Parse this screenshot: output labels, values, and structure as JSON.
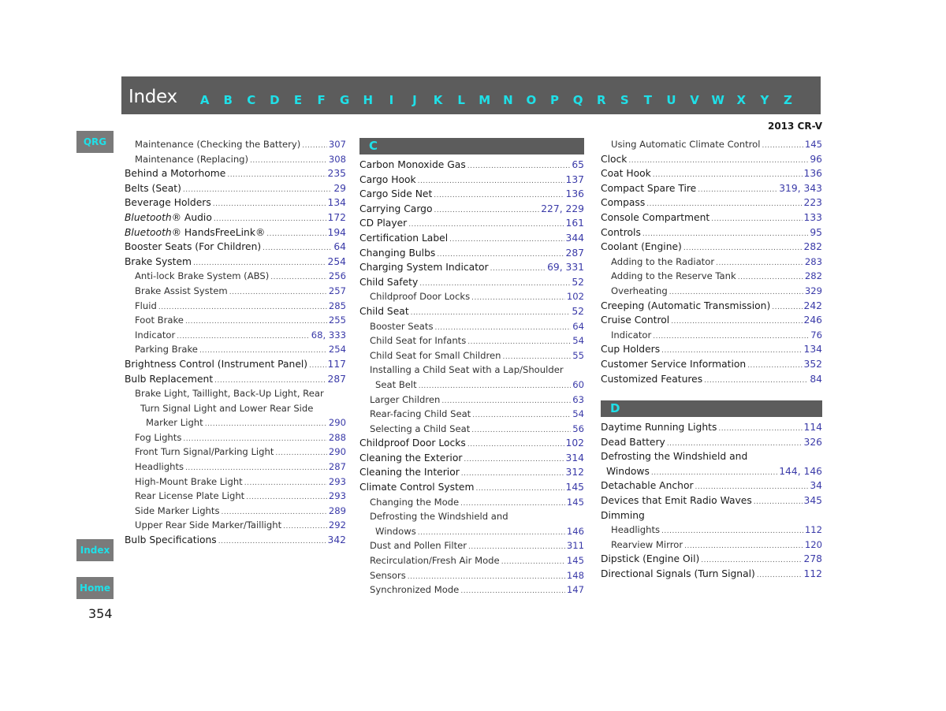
{
  "header": {
    "title": "Index",
    "letters": [
      "A",
      "B",
      "C",
      "D",
      "E",
      "F",
      "G",
      "H",
      "I",
      "J",
      "K",
      "L",
      "M",
      "N",
      "O",
      "P",
      "Q",
      "R",
      "S",
      "T",
      "U",
      "V",
      "W",
      "X",
      "Y",
      "Z"
    ]
  },
  "model": "2013 CR-V",
  "side_buttons": {
    "qrg": "QRG",
    "index": "Index",
    "home": "Home"
  },
  "page_number": "354",
  "columns": {
    "left": [
      {
        "label": "Maintenance (Checking the Battery)",
        "page": "307",
        "level": 1
      },
      {
        "label": "Maintenance (Replacing)",
        "page": "308",
        "level": 1
      },
      {
        "label": "Behind a Motorhome",
        "page": "235",
        "level": 0
      },
      {
        "label": "Belts (Seat)",
        "page": "29",
        "level": 0
      },
      {
        "label": "Beverage Holders",
        "page": "134",
        "level": 0
      },
      {
        "label_italic": "Bluetooth",
        "label": "® Audio",
        "page": "172",
        "level": 0
      },
      {
        "label_italic": "Bluetooth",
        "label": "® HandsFreeLink®",
        "page": "194",
        "level": 0
      },
      {
        "label": "Booster Seats (For Children)",
        "page": "64",
        "level": 0
      },
      {
        "label": "Brake System",
        "page": "254",
        "level": 0
      },
      {
        "label": "Anti-lock Brake System (ABS)",
        "page": "256",
        "level": 1
      },
      {
        "label": "Brake Assist System",
        "page": "257",
        "level": 1
      },
      {
        "label": "Fluid",
        "page": "285",
        "level": 1
      },
      {
        "label": "Foot Brake",
        "page": "255",
        "level": 1
      },
      {
        "label": "Indicator",
        "page": "68, 333",
        "level": 1
      },
      {
        "label": "Parking Brake",
        "page": "254",
        "level": 1
      },
      {
        "label": "Brightness Control (Instrument Panel)",
        "page": "117",
        "level": 0
      },
      {
        "label": "Bulb Replacement",
        "page": "287",
        "level": 0
      },
      {
        "label": "Brake Light, Taillight, Back-Up Light, Rear",
        "page": "",
        "level": 1
      },
      {
        "label": "Turn Signal Light and Lower Rear Side",
        "page": "",
        "level": 2
      },
      {
        "label": "Marker Light",
        "page": "290",
        "level": 3
      },
      {
        "label": "Fog Lights",
        "page": "288",
        "level": 1
      },
      {
        "label": "Front Turn Signal/Parking Light",
        "page": "290",
        "level": 1
      },
      {
        "label": "Headlights",
        "page": "287",
        "level": 1
      },
      {
        "label": "High-Mount Brake Light",
        "page": "293",
        "level": 1
      },
      {
        "label": "Rear License Plate Light",
        "page": "293",
        "level": 1
      },
      {
        "label": "Side Marker Lights",
        "page": "289",
        "level": 1
      },
      {
        "label": "Upper Rear Side Marker/Taillight",
        "page": "292",
        "level": 1
      },
      {
        "label": "Bulb Specifications",
        "page": "342",
        "level": 0
      }
    ],
    "middle_section": "C",
    "middle": [
      {
        "label": "Carbon Monoxide Gas",
        "page": "65",
        "level": 0
      },
      {
        "label": "Cargo Hook",
        "page": "137",
        "level": 0
      },
      {
        "label": "Cargo Side Net",
        "page": "136",
        "level": 0
      },
      {
        "label": "Carrying Cargo",
        "page": "227, 229",
        "level": 0
      },
      {
        "label": "CD Player",
        "page": "161",
        "level": 0
      },
      {
        "label": "Certification Label",
        "page": "344",
        "level": 0
      },
      {
        "label": "Changing Bulbs",
        "page": "287",
        "level": 0
      },
      {
        "label": "Charging System Indicator",
        "page": "69, 331",
        "level": 0
      },
      {
        "label": "Child Safety",
        "page": "52",
        "level": 0
      },
      {
        "label": "Childproof Door Locks",
        "page": "102",
        "level": 1
      },
      {
        "label": "Child Seat",
        "page": "52",
        "level": 0
      },
      {
        "label": "Booster Seats",
        "page": "64",
        "level": 1
      },
      {
        "label": "Child Seat for Infants",
        "page": "54",
        "level": 1
      },
      {
        "label": "Child Seat for Small Children",
        "page": "55",
        "level": 1
      },
      {
        "label": "Installing a Child Seat with a Lap/Shoulder",
        "page": "",
        "level": 1
      },
      {
        "label": "Seat Belt",
        "page": "60",
        "level": 2
      },
      {
        "label": "Larger Children",
        "page": "63",
        "level": 1
      },
      {
        "label": "Rear-facing Child Seat",
        "page": "54",
        "level": 1
      },
      {
        "label": "Selecting a Child Seat",
        "page": "56",
        "level": 1
      },
      {
        "label": "Childproof Door Locks",
        "page": "102",
        "level": 0
      },
      {
        "label": "Cleaning the Exterior",
        "page": "314",
        "level": 0
      },
      {
        "label": "Cleaning the Interior",
        "page": "312",
        "level": 0
      },
      {
        "label": "Climate Control System",
        "page": "145",
        "level": 0
      },
      {
        "label": "Changing the Mode",
        "page": "145",
        "level": 1
      },
      {
        "label": "Defrosting the Windshield and",
        "page": "",
        "level": 1
      },
      {
        "label": "Windows",
        "page": "146",
        "level": 2
      },
      {
        "label": "Dust and Pollen Filter",
        "page": "311",
        "level": 1
      },
      {
        "label": "Recirculation/Fresh Air Mode",
        "page": "145",
        "level": 1
      },
      {
        "label": "Sensors",
        "page": "148",
        "level": 1
      },
      {
        "label": "Synchronized Mode",
        "page": "147",
        "level": 1
      }
    ],
    "right": [
      {
        "label": "Using Automatic Climate Control",
        "page": "145",
        "level": 1
      },
      {
        "label": "Clock",
        "page": "96",
        "level": 0
      },
      {
        "label": "Coat Hook",
        "page": "136",
        "level": 0
      },
      {
        "label": "Compact Spare Tire",
        "page": "319, 343",
        "level": 0
      },
      {
        "label": "Compass",
        "page": "223",
        "level": 0
      },
      {
        "label": "Console Compartment",
        "page": "133",
        "level": 0
      },
      {
        "label": "Controls",
        "page": "95",
        "level": 0
      },
      {
        "label": "Coolant (Engine)",
        "page": "282",
        "level": 0
      },
      {
        "label": "Adding to the Radiator",
        "page": "283",
        "level": 1
      },
      {
        "label": "Adding to the Reserve Tank",
        "page": "282",
        "level": 1
      },
      {
        "label": "Overheating",
        "page": "329",
        "level": 1
      },
      {
        "label": "Creeping (Automatic Transmission)",
        "page": "242",
        "level": 0
      },
      {
        "label": "Cruise Control",
        "page": "246",
        "level": 0
      },
      {
        "label": "Indicator",
        "page": "76",
        "level": 1
      },
      {
        "label": "Cup Holders",
        "page": "134",
        "level": 0
      },
      {
        "label": "Customer Service Information",
        "page": "352",
        "level": 0
      },
      {
        "label": "Customized Features",
        "page": "84",
        "level": 0
      }
    ],
    "right_section": "D",
    "right_d": [
      {
        "label": "Daytime Running Lights",
        "page": "114",
        "level": 0
      },
      {
        "label": "Dead Battery",
        "page": "326",
        "level": 0
      },
      {
        "label": "Defrosting the Windshield and",
        "page": "",
        "level": 0
      },
      {
        "label": "Windows",
        "page": "144, 146",
        "level": 4
      },
      {
        "label": "Detachable Anchor",
        "page": "34",
        "level": 0
      },
      {
        "label": "Devices that Emit Radio Waves",
        "page": "345",
        "level": 0
      },
      {
        "label": "Dimming",
        "page": "",
        "level": 0
      },
      {
        "label": "Headlights",
        "page": "112",
        "level": 1
      },
      {
        "label": "Rearview Mirror",
        "page": "120",
        "level": 1
      },
      {
        "label": "Dipstick (Engine Oil)",
        "page": "278",
        "level": 0
      },
      {
        "label": "Directional Signals (Turn Signal)",
        "page": "112",
        "level": 0
      }
    ]
  }
}
